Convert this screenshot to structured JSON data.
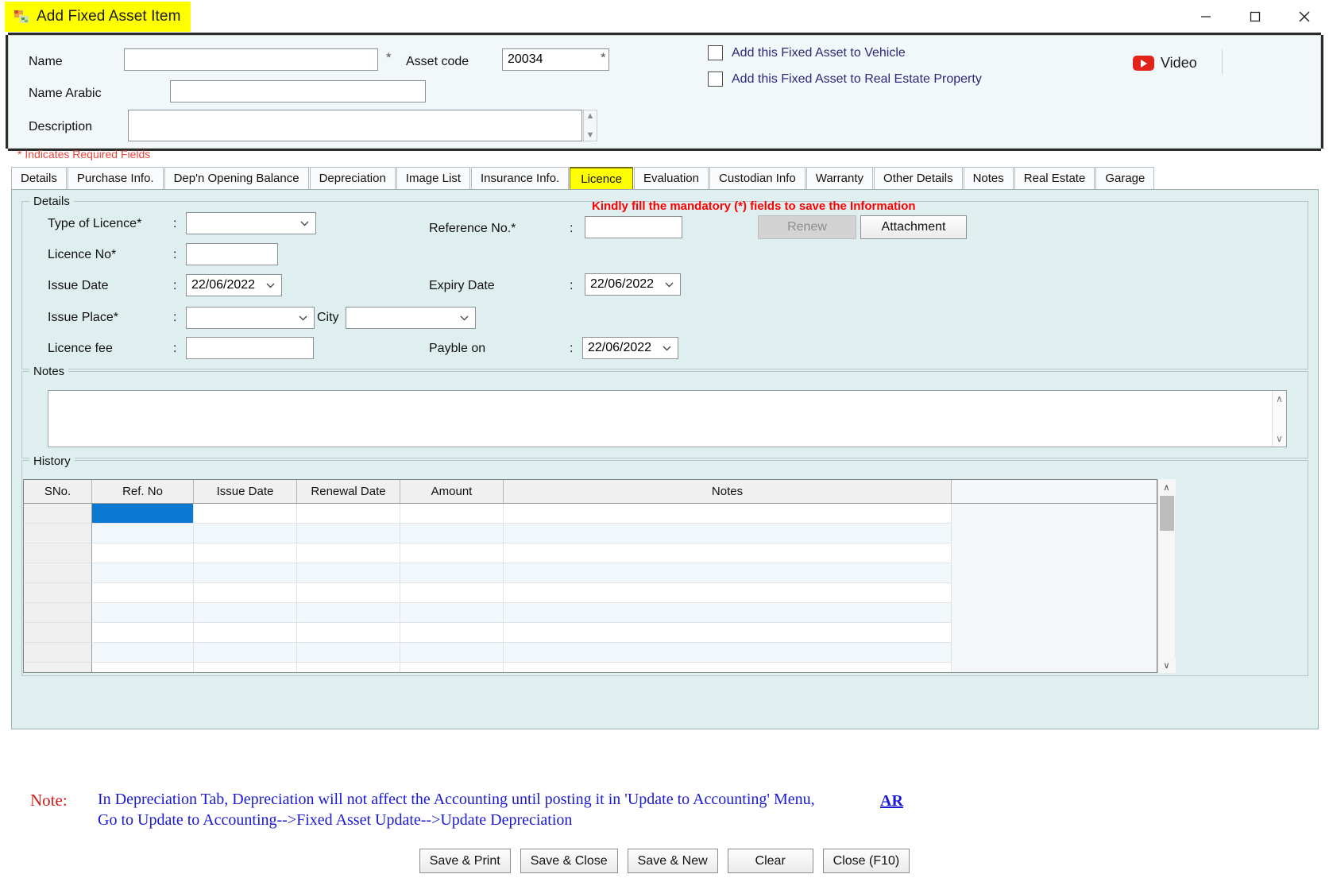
{
  "window": {
    "title": "Add Fixed Asset Item",
    "icon": "app-window-icon",
    "minimize": "─",
    "maximize": "□",
    "close": "✕"
  },
  "header": {
    "name_label": "Name",
    "name_value": "",
    "name_required": "*",
    "asset_code_label": "Asset code",
    "asset_code_value": "20034",
    "asset_code_required": "*",
    "name_arabic_label": "Name Arabic",
    "name_arabic_value": "",
    "description_label": "Description",
    "description_value": "",
    "checkbox_vehicle": "Add this Fixed Asset to Vehicle",
    "checkbox_real_estate": "Add this Fixed Asset to Real Estate Property",
    "video_label": "Video",
    "colors": {
      "checkbox_label": "#2b2a7a",
      "youtube_red": "#e2231a",
      "highlight": "#ffff00"
    }
  },
  "required_fields_note": "* Indicates Required Fields",
  "tabs": [
    {
      "label": "Details",
      "active": false
    },
    {
      "label": "Purchase Info.",
      "active": false
    },
    {
      "label": "Dep'n Opening Balance",
      "active": false
    },
    {
      "label": "Depreciation",
      "active": false
    },
    {
      "label": "Image List",
      "active": false
    },
    {
      "label": "Insurance Info.",
      "active": false
    },
    {
      "label": "Licence",
      "active": true
    },
    {
      "label": "Evaluation",
      "active": false
    },
    {
      "label": "Custodian Info",
      "active": false
    },
    {
      "label": "Warranty",
      "active": false
    },
    {
      "label": "Other Details",
      "active": false
    },
    {
      "label": "Notes",
      "active": false
    },
    {
      "label": "Real Estate",
      "active": false
    },
    {
      "label": "Garage",
      "active": false
    }
  ],
  "licence": {
    "details_group_label": "Details",
    "mandatory_message": "Kindly fill the mandatory (*) fields to save the Information",
    "type_of_licence_label": "Type of Licence*",
    "type_of_licence_value": "",
    "licence_no_label": "Licence No*",
    "licence_no_value": "",
    "issue_date_label": "Issue Date",
    "issue_date_value": "22/06/2022",
    "issue_place_label": "Issue Place*",
    "issue_place_value": "",
    "city_label": "City",
    "city_value": "",
    "licence_fee_label": "Licence fee",
    "licence_fee_value": "",
    "reference_no_label": "Reference No.*",
    "reference_no_value": "",
    "expiry_date_label": "Expiry Date",
    "expiry_date_value": "22/06/2022",
    "payble_on_label": "Payble on",
    "payble_on_value": "22/06/2022",
    "renew_button": "Renew",
    "renew_disabled": true,
    "attachment_button": "Attachment",
    "colon": ":",
    "caret": "⌄"
  },
  "notes_group": {
    "label": "Notes",
    "value": "",
    "scroll_up": "∧",
    "scroll_down": "∨"
  },
  "history": {
    "label": "History",
    "columns": [
      "SNo.",
      "Ref. No",
      "Issue Date",
      "Renewal Date",
      "Amount",
      "Notes"
    ],
    "rows": [
      {
        "sno": "",
        "ref_no": "",
        "issue_date": "",
        "renewal_date": "",
        "amount": "",
        "notes": "",
        "selected_cell": "ref_no"
      },
      {
        "sno": "",
        "ref_no": "",
        "issue_date": "",
        "renewal_date": "",
        "amount": "",
        "notes": ""
      },
      {
        "sno": "",
        "ref_no": "",
        "issue_date": "",
        "renewal_date": "",
        "amount": "",
        "notes": ""
      },
      {
        "sno": "",
        "ref_no": "",
        "issue_date": "",
        "renewal_date": "",
        "amount": "",
        "notes": ""
      },
      {
        "sno": "",
        "ref_no": "",
        "issue_date": "",
        "renewal_date": "",
        "amount": "",
        "notes": ""
      },
      {
        "sno": "",
        "ref_no": "",
        "issue_date": "",
        "renewal_date": "",
        "amount": "",
        "notes": ""
      },
      {
        "sno": "",
        "ref_no": "",
        "issue_date": "",
        "renewal_date": "",
        "amount": "",
        "notes": ""
      },
      {
        "sno": "",
        "ref_no": "",
        "issue_date": "",
        "renewal_date": "",
        "amount": "",
        "notes": ""
      },
      {
        "sno": "",
        "ref_no": "",
        "issue_date": "",
        "renewal_date": "",
        "amount": "",
        "notes": ""
      }
    ],
    "scroll_up": "∧",
    "scroll_down": "∨",
    "selection_color": "#0b78d1"
  },
  "footer": {
    "note_label": "Note:",
    "note_line1": "In Depreciation Tab, Depreciation will not affect the Accounting until posting it in 'Update to Accounting' Menu,",
    "note_line2": "Go to Update to Accounting-->Fixed Asset Update-->Update Depreciation",
    "ar_link": "AR",
    "buttons": [
      "Save & Print",
      "Save & Close",
      "Save & New",
      "Clear",
      "Close (F10)"
    ]
  }
}
